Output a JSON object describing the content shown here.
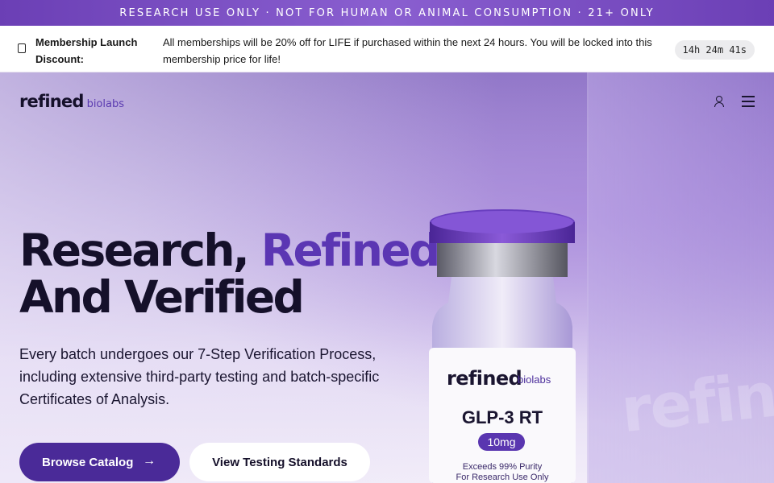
{
  "announcement": "RESEARCH USE ONLY · NOT FOR HUMAN OR ANIMAL CONSUMPTION · 21+ ONLY",
  "promo": {
    "icon": "tag-icon",
    "title": "Membership Launch Discount:",
    "message": "All memberships will be 20% off for LIFE if purchased within the next 24 hours. You will be locked into this membership price for life!",
    "timer": "14h 24m 41s"
  },
  "nav": {
    "logo_main": "refined",
    "logo_sub": "biolabs",
    "icons": [
      "user-icon",
      "menu-icon"
    ]
  },
  "hero": {
    "headline_part1": "Research, ",
    "headline_accent": "Refined",
    "headline_line2": "And Verified",
    "subtext": "Every batch undergoes our 7-Step Verification Process, including extensive third-party testing and batch-specific Certificates of Analysis.",
    "primary_button": "Browse Catalog",
    "primary_arrow": "→",
    "secondary_button": "View Testing Standards",
    "background_text": "refined"
  },
  "product": {
    "brand_main": "refined",
    "brand_sub": "biolabs",
    "name": "GLP-3 RT",
    "dose": "10mg",
    "purity_line1": "Exceeds 99% Purity",
    "purity_line2": "For Research Use Only"
  },
  "colors": {
    "brand_purple": "#5b36b3",
    "button_purple": "#4a2a98",
    "text_dark": "#15102a"
  }
}
